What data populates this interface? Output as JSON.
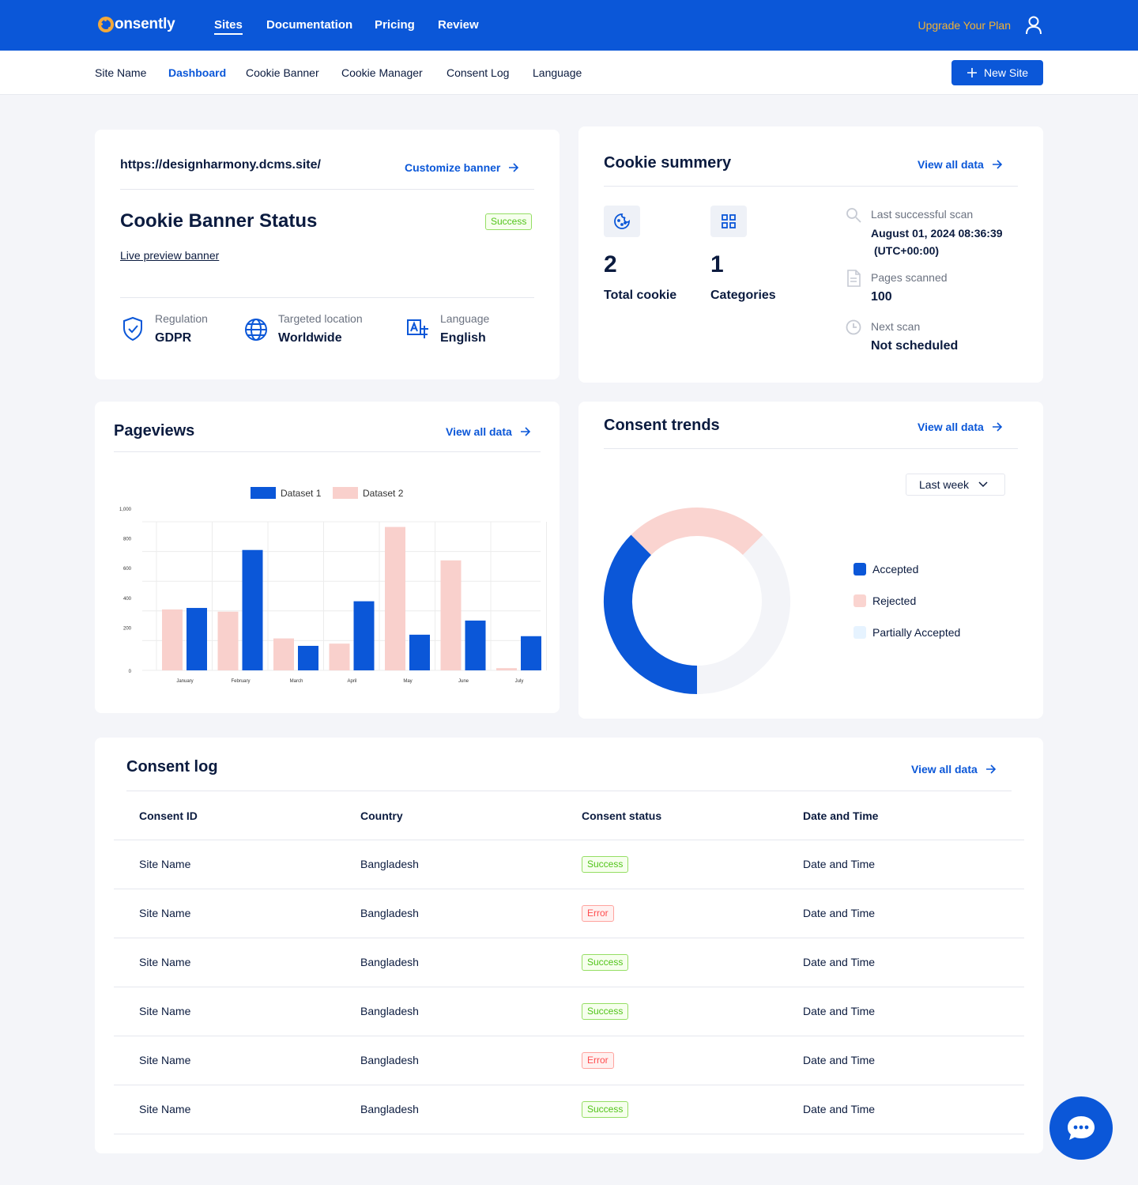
{
  "header": {
    "logo_text": "onsently",
    "nav": [
      "Sites",
      "Documentation",
      "Pricing",
      "Review"
    ],
    "upgrade_label": "Upgrade Your Plan",
    "user_icon": "user-icon"
  },
  "subnav": {
    "items": [
      "Site Name",
      "Dashboard",
      "Cookie Banner",
      "Cookie Manager",
      "Consent Log",
      "Language"
    ],
    "active": "Dashboard",
    "new_site_label": "New Site"
  },
  "banner_card": {
    "url": "https://designharmony.dcms.site/",
    "customize_label": "Customize banner",
    "title": "Cookie Banner Status",
    "status": "Success",
    "preview_link": "Live preview banner",
    "regulation_label": "Regulation",
    "regulation_value": "GDPR",
    "location_label": "Targeted location",
    "location_value": "Worldwide",
    "language_label": "Language",
    "language_value": "English"
  },
  "cookie_summary": {
    "title": "Cookie summery",
    "view_all": "View all data",
    "total_count": "2",
    "total_label": "Total cookie",
    "categories_count": "1",
    "categories_label": "Categories",
    "last_scan_label": "Last successful scan",
    "last_scan_value": "August 01, 2024 08:36:39",
    "last_scan_tz": "(UTC+00:00)",
    "pages_label": "Pages scanned",
    "pages_value": "100",
    "next_scan_label": "Next scan",
    "next_scan_value": "Not scheduled"
  },
  "pageviews": {
    "title": "Pageviews",
    "view_all": "View all data"
  },
  "consent_trends": {
    "title": "Consent trends",
    "view_all": "View all data",
    "range": "Last week",
    "legend": [
      "Accepted",
      "Rejected",
      "Partially Accepted"
    ]
  },
  "consent_log": {
    "title": "Consent log",
    "view_all": "View all data",
    "columns": [
      "Consent ID",
      "Country",
      "Consent status",
      "Date and Time"
    ],
    "rows": [
      {
        "id": "Site Name",
        "country": "Bangladesh",
        "status": "Success",
        "date": "Date and Time"
      },
      {
        "id": "Site Name",
        "country": "Bangladesh",
        "status": "Error",
        "date": "Date and Time"
      },
      {
        "id": "Site Name",
        "country": "Bangladesh",
        "status": "Success",
        "date": "Date and Time"
      },
      {
        "id": "Site Name",
        "country": "Bangladesh",
        "status": "Success",
        "date": "Date and Time"
      },
      {
        "id": "Site Name",
        "country": "Bangladesh",
        "status": "Error",
        "date": "Date and Time"
      },
      {
        "id": "Site Name",
        "country": "Bangladesh",
        "status": "Success",
        "date": "Date and Time"
      }
    ]
  },
  "chart_data": [
    {
      "type": "bar",
      "categories": [
        "January",
        "February",
        "March",
        "April",
        "May",
        "June",
        "July"
      ],
      "series": [
        {
          "name": "Dataset 1",
          "values": [
            420,
            810,
            165,
            465,
            240,
            335,
            230
          ],
          "color": "#0b57d8"
        },
        {
          "name": "Dataset 2",
          "values": [
            410,
            395,
            215,
            180,
            965,
            740,
            15
          ],
          "color": "#f9d0cc"
        }
      ],
      "title": "",
      "xlabel": "",
      "ylabel": "",
      "yticks": [
        "0",
        "200",
        "400",
        "600",
        "800",
        "1,000"
      ],
      "ylim": [
        0,
        1000
      ],
      "grid": true,
      "legend": "top-center"
    },
    {
      "type": "pie",
      "categories": [
        "Accepted",
        "Rejected",
        "Partially Accepted"
      ],
      "values": [
        37.5,
        25,
        37.5
      ],
      "colors": [
        "#0b57d8",
        "#fad4d0",
        "#f3f4f8"
      ],
      "legend": "right"
    }
  ],
  "chat": {
    "icon": "chat-icon"
  }
}
